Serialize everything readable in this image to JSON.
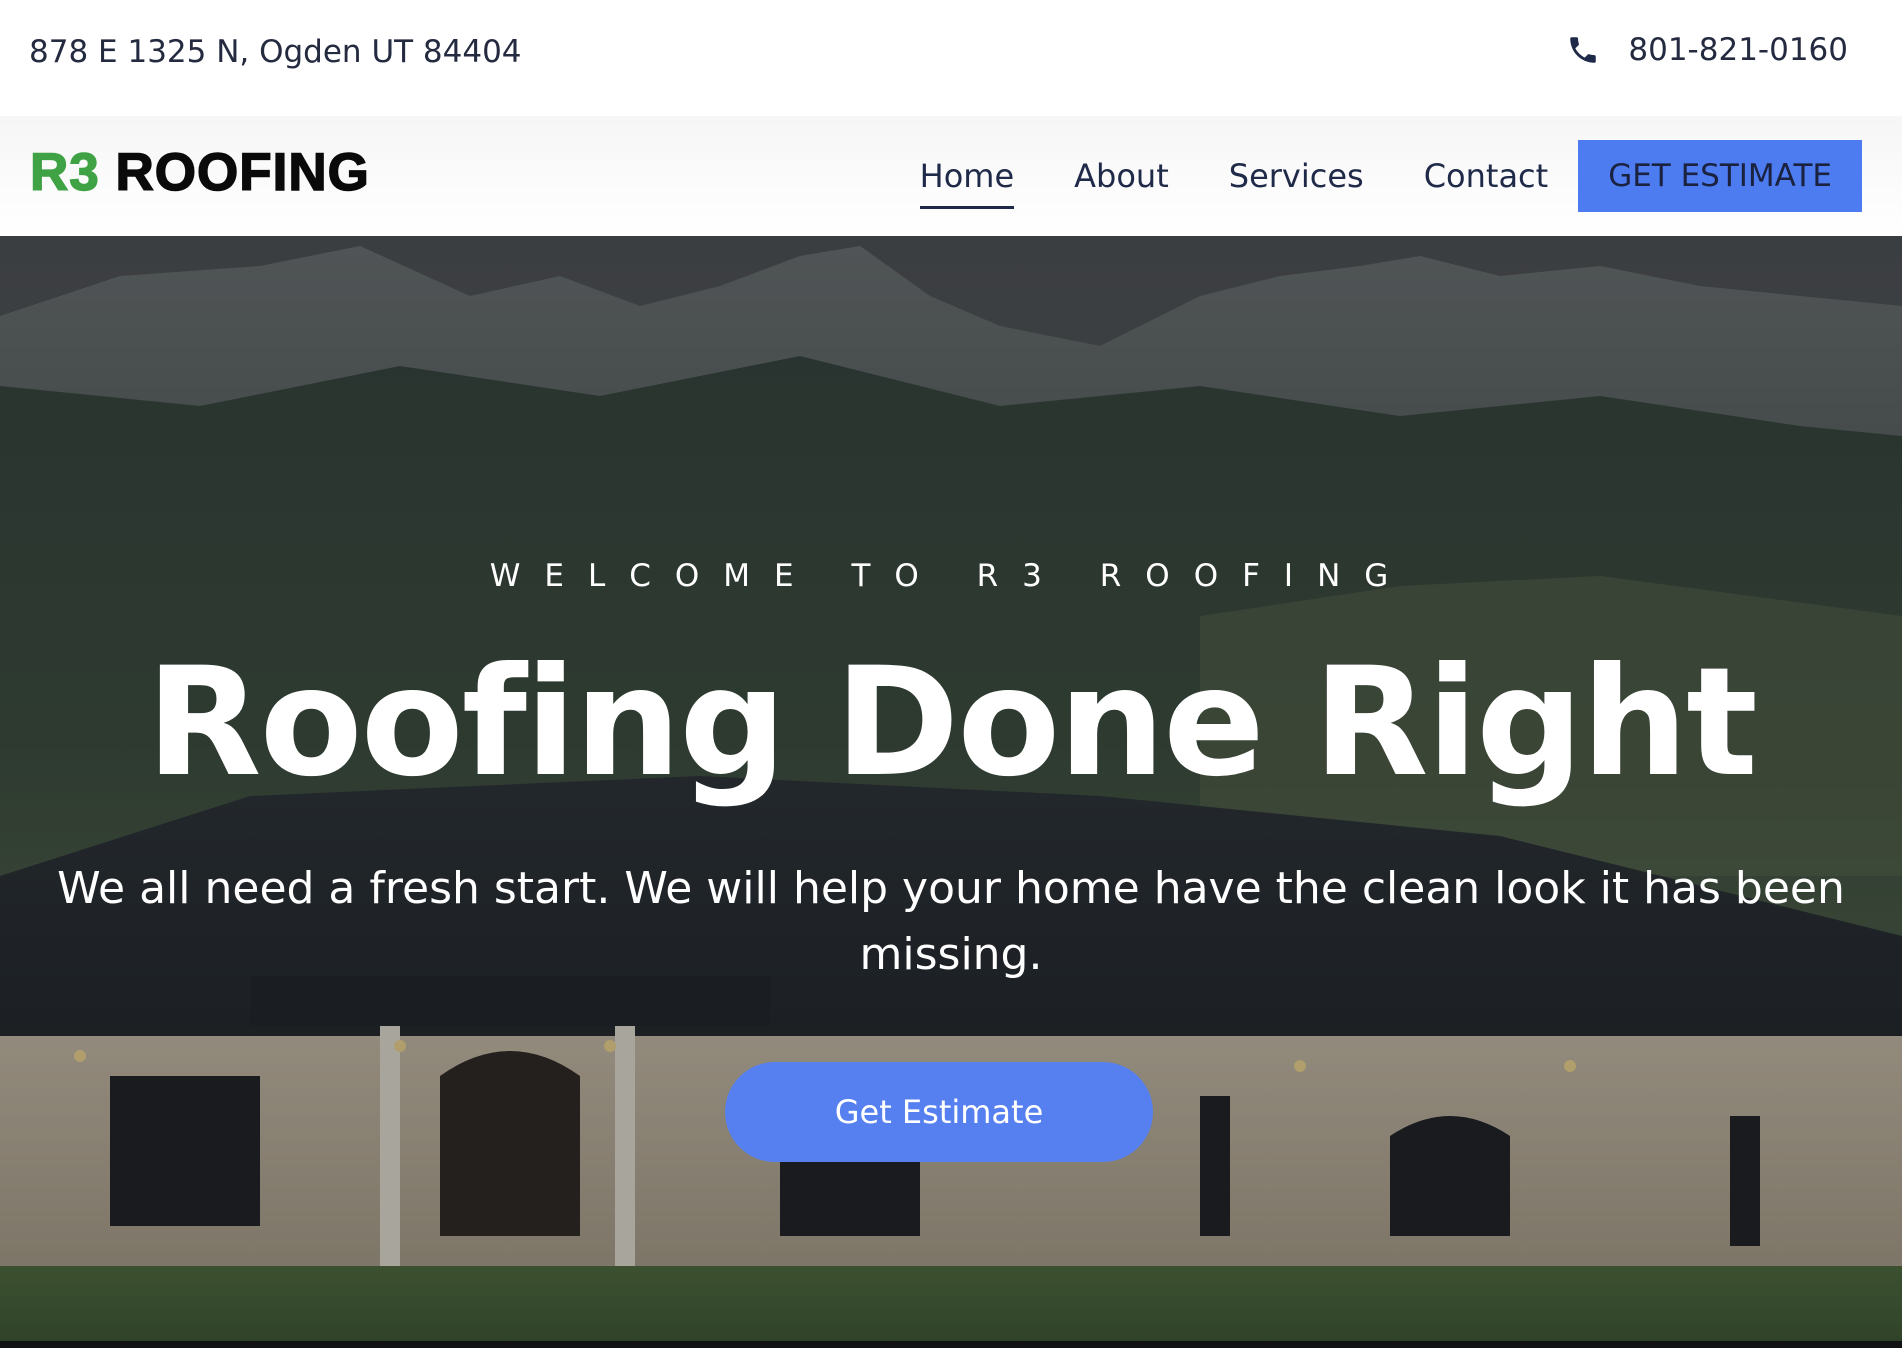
{
  "topbar": {
    "address": "878 E 1325 N, Ogden UT 84404",
    "phone_icon": "phone-icon",
    "phone": "801-821-0160"
  },
  "nav": {
    "logo_r3": "R3",
    "logo_roofing": "ROOFING",
    "links": [
      {
        "label": "Home",
        "active": true
      },
      {
        "label": "About",
        "active": false
      },
      {
        "label": "Services",
        "active": false
      },
      {
        "label": "Contact",
        "active": false
      }
    ],
    "cta_label": "GET ESTIMATE"
  },
  "hero": {
    "eyebrow": "WELCOME TO R3 ROOFING",
    "headline": "Roofing Done Right",
    "subtext": "We all need a fresh start. We will help your home have the clean look it has been missing.",
    "cta_label": "Get Estimate",
    "background": "mountains-and-house-photo"
  },
  "colors": {
    "brand_green": "#3fa245",
    "accent_blue": "#4d7cf1",
    "text_dark": "#1f2a48"
  }
}
